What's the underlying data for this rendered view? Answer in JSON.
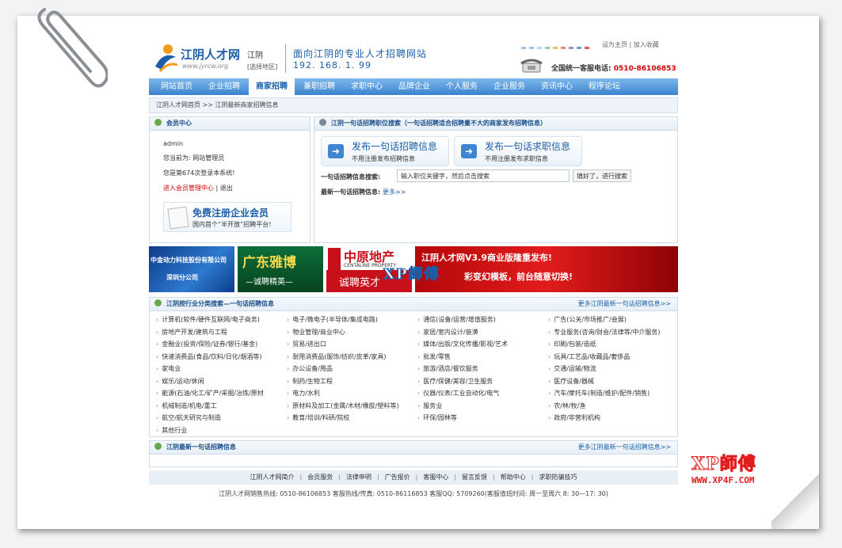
{
  "header": {
    "logo_text": "江阴人才网",
    "logo_url": "www.jyrcw.org",
    "city": "江阴",
    "city_select": "[选择地区]",
    "slogan": "面向江阴的专业人才招聘网站",
    "ip": "192. 168. 1. 99",
    "top_links": "设为主页 | 加入收藏",
    "hotline_label": "全国统一客服电话:",
    "hotline_number": "0510-86106853",
    "dot_colors": [
      "#9ec3e6",
      "#9ec3e6",
      "#c3d7ea",
      "#8fd0a0",
      "#f0c060",
      "#e58a8a",
      "#a58ad8",
      "#6aa0d8",
      "#e06060"
    ]
  },
  "nav": [
    "网站首页",
    "企业招聘",
    "商家招聘",
    "兼职招聘",
    "求职中心",
    "品牌企业",
    "个人服务",
    "企业服务",
    "资讯中心",
    "程序论坛"
  ],
  "breadcrumb": "江阴人才网首页 >> 江阴最新商家招聘信息",
  "member": {
    "title": "会员中心",
    "username": "admin",
    "role": "您当前为: 网站管理员",
    "login_count": "您是第674次登录本系统!",
    "manage_link": "进入会员管理中心",
    "logout": "退出",
    "reg_title": "免费注册企业会员",
    "reg_sub": "国内首个“半开放”招聘平台!"
  },
  "search": {
    "title": "江阴一句话招聘职位搜索（一句话招聘适合招聘量不大的商家发布招聘信息）",
    "publish_job": "发布一句话招聘信息",
    "publish_job_sub": "不用注册发布招聘信息",
    "publish_resume": "发布一句话求职信息",
    "publish_resume_sub": "不用注册发布求职信息",
    "keyword_label": "一句话招聘信息搜索:",
    "keyword_placeholder": "输入职位关键字，然后点击搜索",
    "search_button": "填好了，进行搜索",
    "latest_label": "最新一句话招聘信息:",
    "more": "更多>>"
  },
  "banners": {
    "b1_line1": "中金动力科技股份有限公司",
    "b1_line2": "深圳分公司",
    "b2_line1": "广东雅博",
    "b2_line2": "—诚聘精英—",
    "b3_line1": "中原地产",
    "b3_line2": "CENTALINE PROPERTY",
    "b3_line3": "诚聘英才",
    "b4_line1": "江阴人才网V3.9商业版隆重发布!",
    "b4_line2": "彩变幻模板，前台随意切换!"
  },
  "category": {
    "title": "江阴按行业分类搜索—一句话招聘信息",
    "more": "更多江阴最新一句话招聘信息>>",
    "items": [
      "计算机(软件/硬件互联网/电子商务)",
      "电子/微电子(半导体/集成电路)",
      "通信(设备/运营/增值服务)",
      "广告(公关/市场推广/会展)",
      "房地产开发/建筑与工程",
      "物业管理/商业中心",
      "家居/室内设计/装潢",
      "专业服务(咨询/财会/法律等/中介服务)",
      "金融业(投资/保险/证券/银行/基金)",
      "贸易/进出口",
      "媒体/出版/文化传播/影视/艺术",
      "印刷/包装/造纸",
      "快速消费品(食品/饮料/日化/烟酒等)",
      "耐用消费品(服饰/纺织/皮革/家具)",
      "批发/零售",
      "玩具/工艺品/收藏品/奢侈品",
      "家电业",
      "办公设备/用品",
      "旅游/酒店/餐饮服务",
      "交通/运输/物流",
      "娱乐/运动/休闲",
      "制药/生物工程",
      "医疗/保健/美容/卫生服务",
      "医疗设备/器械",
      "能源(石油/化工/矿产/采掘/冶炼/原材",
      "电力/水利",
      "仪器/仪表/工业自动化/电气",
      "汽车/摩托车(制造/维护/配件/销售)",
      "机械制造/机电/重工",
      "原材料及加工(金属/木材/橡胶/塑料等)",
      "服务业",
      "农/林/牧/渔",
      "航空/航天研究与制造",
      "教育/培训/科研/院校",
      "环保/园林等",
      "政府/非营利机构",
      "其他行业"
    ]
  },
  "latest": {
    "title": "江阴最新一句话招聘信息",
    "more": "更多江阴最新一句话招聘信息>>"
  },
  "footer": {
    "links": [
      "江阴人才网简介",
      "会员服务",
      "法律申明",
      "广告报价",
      "客服中心",
      "留言反馈",
      "帮助中心",
      "求职防骗技巧"
    ],
    "info": "江阴人才网销售热线: 0510-86106853    客服热线/传真: 0510-86116853    客服QQ: 5709260(客服值班时间: 周一至周六 8: 30—17: 30)"
  },
  "watermarks": {
    "center": "XP師傅",
    "corner": "XP師傅",
    "corner_url": "WWW.XP4F.COM"
  }
}
